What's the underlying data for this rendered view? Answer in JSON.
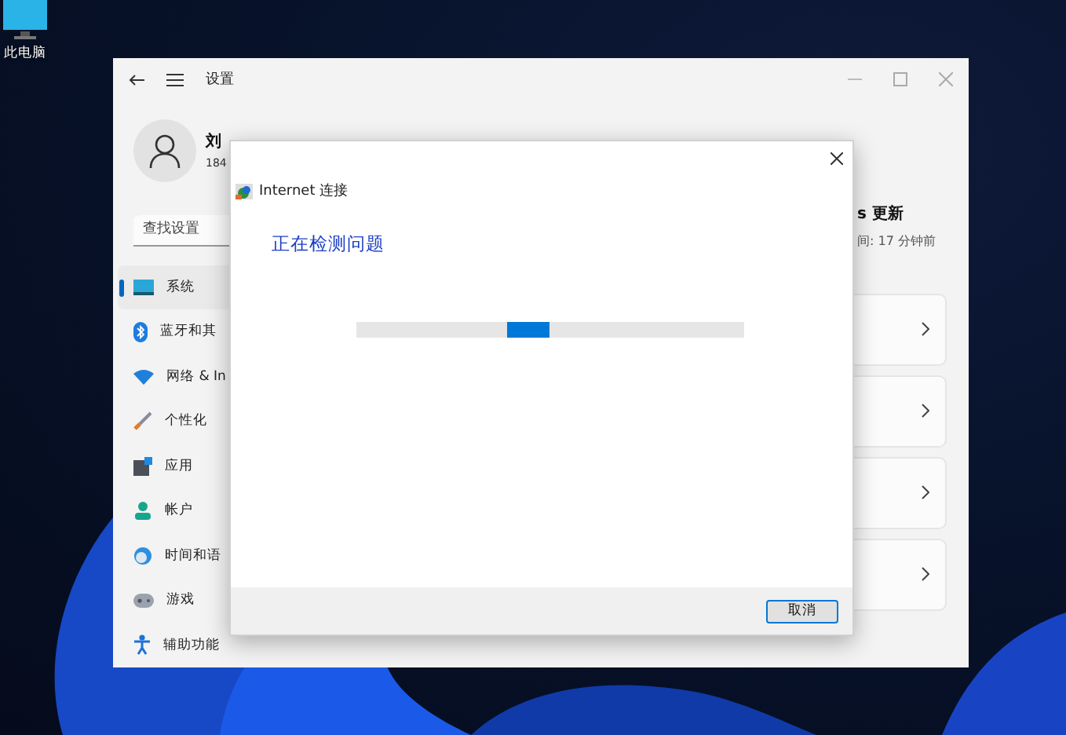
{
  "desktop": {
    "icon_label": "此电脑"
  },
  "settings": {
    "title": "设置",
    "user": {
      "name": "刘",
      "email": "184"
    },
    "search": {
      "placeholder": "查找设置"
    },
    "nav": [
      {
        "label": "系统",
        "kind": "system",
        "selected": true
      },
      {
        "label": "蓝牙和其",
        "kind": "bluetooth",
        "selected": false
      },
      {
        "label": "网络 & In",
        "kind": "network",
        "selected": false
      },
      {
        "label": "个性化",
        "kind": "brush",
        "selected": false
      },
      {
        "label": "应用",
        "kind": "apps",
        "selected": false
      },
      {
        "label": "帐户",
        "kind": "account",
        "selected": false
      },
      {
        "label": "时间和语",
        "kind": "time",
        "selected": false
      },
      {
        "label": "游戏",
        "kind": "game",
        "selected": false
      },
      {
        "label": "辅助功能",
        "kind": "access",
        "selected": false
      }
    ],
    "update": {
      "title": "s 更新",
      "time": "间: 17 分钟前"
    }
  },
  "dialog": {
    "title": "Internet 连接",
    "heading": "正在检测问题",
    "buttons": [
      "取消"
    ]
  }
}
